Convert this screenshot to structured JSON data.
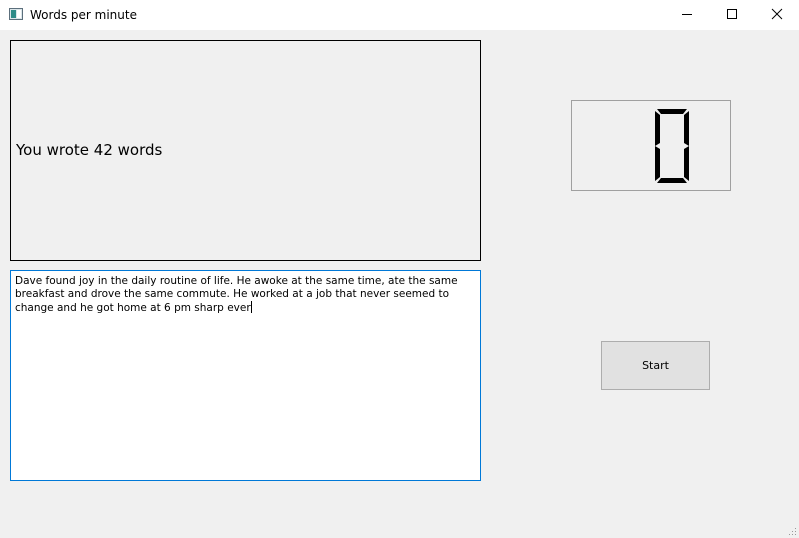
{
  "window": {
    "title": "Words per minute",
    "icon": "app-window-icon",
    "controls": [
      "minimize-icon",
      "maximize-icon",
      "close-icon"
    ]
  },
  "result_display": {
    "text": "You wrote 42 words"
  },
  "text_editor": {
    "value": "Dave found joy in the daily routine of life. He awoke at the same time, ate the same breakfast and drove the same commute. He worked at a job that never seemed to change and he got home at 6 pm sharp ever"
  },
  "lcd_counter": {
    "value": "0"
  },
  "start_button": {
    "label": "Start"
  },
  "colors": {
    "window_bg": "#f0f0f0",
    "titlebar_bg": "#ffffff",
    "editor_focus_border": "#0078d7",
    "button_bg": "#e1e1e1"
  }
}
